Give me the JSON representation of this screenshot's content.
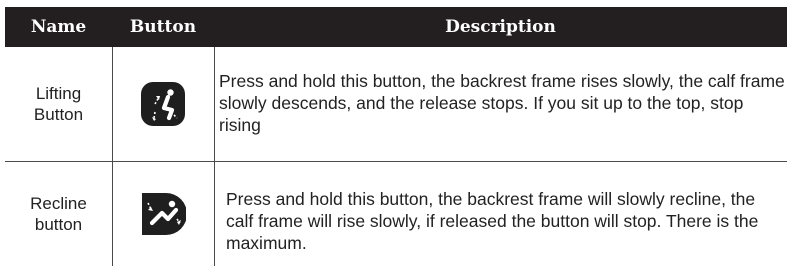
{
  "partial_heading": "",
  "table": {
    "columns": {
      "name": "Name",
      "button": "Button",
      "description": "Description"
    },
    "rows": [
      {
        "name": "Lifting Button",
        "icon": "lift-seat-icon",
        "description": "Press and hold this button, the backrest frame rises slowly, the calf frame slowly descends, and the release stops. If you sit up to the top, stop rising"
      },
      {
        "name": "Recline button",
        "icon": "recline-seat-icon",
        "description": "Press and hold this button, the backrest frame will slowly recline, the calf frame will rise slowly, if released the button will stop. There is the maximum."
      }
    ]
  },
  "colors": {
    "header_bg": "#231f20",
    "header_text": "#ffffff",
    "icon_bg": "#1f1f1f",
    "border": "#4a4a4a"
  }
}
